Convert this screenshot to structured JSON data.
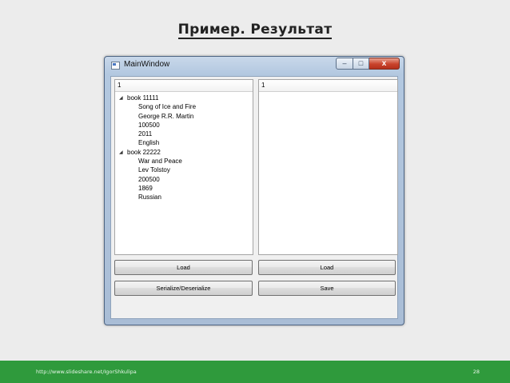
{
  "slide": {
    "title": "Пример. Результат",
    "footer_link": "http://www.slideshare.net/IgorShkulipa",
    "page_number": "28"
  },
  "window": {
    "title": "MainWindow",
    "controls": {
      "minimize": "–",
      "maximize": "□",
      "close": "x"
    }
  },
  "left_pane": {
    "header": "1",
    "books": [
      {
        "label": "book 11111",
        "expanded": true,
        "fields": [
          "Song of Ice and Fire",
          "George R.R. Martin",
          "100500",
          "2011",
          "English"
        ]
      },
      {
        "label": "book 22222",
        "expanded": true,
        "fields": [
          "War and Peace",
          "Lev Tolstoy",
          "200500",
          "1869",
          "Russian"
        ]
      }
    ]
  },
  "right_pane": {
    "header": "1"
  },
  "buttons": {
    "left_load": "Load",
    "right_load": "Load",
    "serialize": "Serialize/Deserialize",
    "save": "Save"
  },
  "colors": {
    "footer_bar": "#2f9a3c",
    "close_button": "#c9432b"
  },
  "icons": {
    "expand_arrow": "triangle-down-right-icon"
  }
}
